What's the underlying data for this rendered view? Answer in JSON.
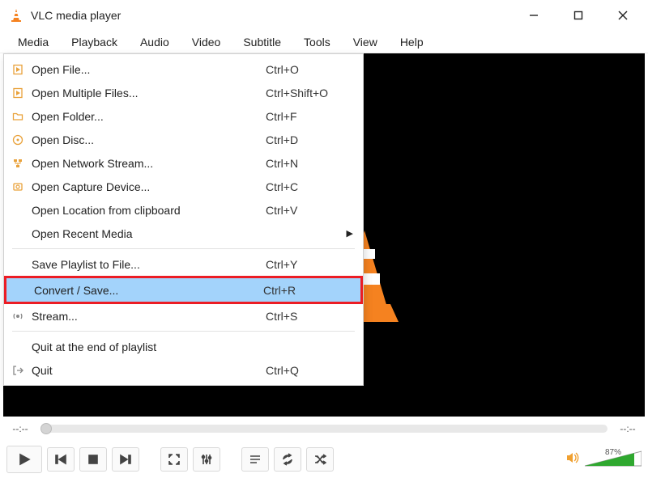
{
  "window": {
    "title": "VLC media player"
  },
  "menubar": [
    "Media",
    "Playback",
    "Audio",
    "Video",
    "Subtitle",
    "Tools",
    "View",
    "Help"
  ],
  "dropdown": {
    "items": [
      {
        "label": "Open File...",
        "shortcut": "Ctrl+O",
        "icon": "file"
      },
      {
        "label": "Open Multiple Files...",
        "shortcut": "Ctrl+Shift+O",
        "icon": "file"
      },
      {
        "label": "Open Folder...",
        "shortcut": "Ctrl+F",
        "icon": "folder"
      },
      {
        "label": "Open Disc...",
        "shortcut": "Ctrl+D",
        "icon": "disc"
      },
      {
        "label": "Open Network Stream...",
        "shortcut": "Ctrl+N",
        "icon": "network"
      },
      {
        "label": "Open Capture Device...",
        "shortcut": "Ctrl+C",
        "icon": "capture"
      },
      {
        "label": "Open Location from clipboard",
        "shortcut": "Ctrl+V",
        "icon": ""
      },
      {
        "label": "Open Recent Media",
        "shortcut": "",
        "icon": "",
        "submenu": true
      },
      {
        "sep": true
      },
      {
        "label": "Save Playlist to File...",
        "shortcut": "Ctrl+Y",
        "icon": ""
      },
      {
        "label": "Convert / Save...",
        "shortcut": "Ctrl+R",
        "icon": "",
        "highlight": true
      },
      {
        "label": "Stream...",
        "shortcut": "Ctrl+S",
        "icon": "stream"
      },
      {
        "sep": true
      },
      {
        "label": "Quit at the end of playlist",
        "shortcut": "",
        "icon": ""
      },
      {
        "label": "Quit",
        "shortcut": "Ctrl+Q",
        "icon": "quit"
      }
    ]
  },
  "playback": {
    "time_current": "--:--",
    "time_total": "--:--",
    "volume_percent": "87%"
  }
}
